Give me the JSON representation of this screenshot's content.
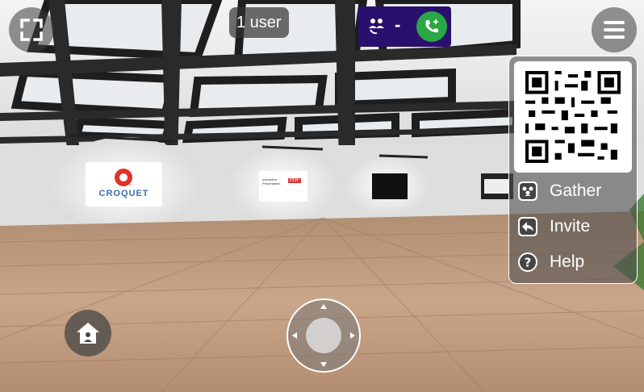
{
  "scene": {
    "logo_text": "CROQUET",
    "pdf_board_title": "Interactive Presentation",
    "pdf_badge": "PDF"
  },
  "toolbar": {
    "user_count": "1 user",
    "call_separator": "-"
  },
  "menu": {
    "items": [
      {
        "label": "Gather",
        "icon": "gather-icon"
      },
      {
        "label": "Invite",
        "icon": "invite-icon"
      },
      {
        "label": "Help",
        "icon": "help-icon"
      }
    ]
  },
  "colors": {
    "call_bar": "#2b0f6e",
    "call_join": "#29a745",
    "croquet_red": "#e0312b"
  }
}
